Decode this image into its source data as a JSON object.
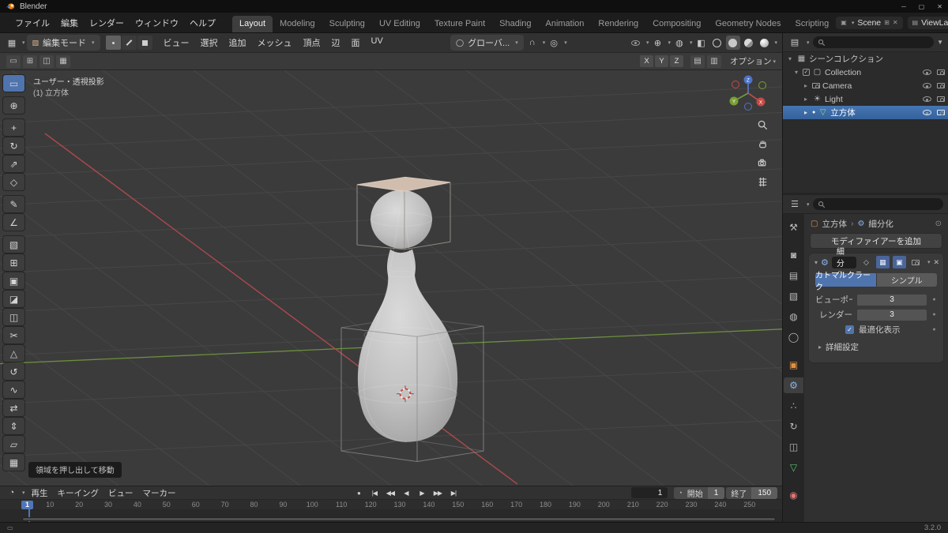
{
  "titlebar": {
    "title": "Blender"
  },
  "topbar": {
    "menus": [
      {
        "name": "file",
        "label": "ファイル"
      },
      {
        "name": "edit",
        "label": "編集"
      },
      {
        "name": "render",
        "label": "レンダー"
      },
      {
        "name": "window",
        "label": "ウィンドウ"
      },
      {
        "name": "help",
        "label": "ヘルプ"
      }
    ],
    "tabs": [
      {
        "name": "layout",
        "label": "Layout",
        "active": true
      },
      {
        "name": "modeling",
        "label": "Modeling"
      },
      {
        "name": "sculpting",
        "label": "Sculpting"
      },
      {
        "name": "uv-editing",
        "label": "UV Editing"
      },
      {
        "name": "texture-paint",
        "label": "Texture Paint"
      },
      {
        "name": "shading",
        "label": "Shading"
      },
      {
        "name": "animation",
        "label": "Animation"
      },
      {
        "name": "rendering",
        "label": "Rendering"
      },
      {
        "name": "compositing",
        "label": "Compositing"
      },
      {
        "name": "geometry-nodes",
        "label": "Geometry Nodes"
      },
      {
        "name": "scripting",
        "label": "Scripting"
      }
    ],
    "scene": {
      "label": "Scene"
    },
    "viewlayer": {
      "label": "ViewLayer"
    }
  },
  "viewport_header": {
    "mode": {
      "label": "編集モード"
    },
    "menus": [
      {
        "name": "view",
        "label": "ビュー"
      },
      {
        "name": "select",
        "label": "選択"
      },
      {
        "name": "add",
        "label": "追加"
      },
      {
        "name": "mesh",
        "label": "メッシュ"
      },
      {
        "name": "vertex",
        "label": "頂点"
      },
      {
        "name": "edge",
        "label": "辺"
      },
      {
        "name": "face",
        "label": "面"
      },
      {
        "name": "uv",
        "label": "UV"
      }
    ],
    "orientation": {
      "label": "グローバ..."
    }
  },
  "tool_settings": {
    "mirror_axes": [
      "X",
      "Y",
      "Z"
    ],
    "options_label": "オプション"
  },
  "tools": [
    {
      "name": "select-box",
      "glyph": "▭",
      "active": true
    },
    {
      "name": "cursor",
      "glyph": "⊕",
      "gap": true
    },
    {
      "name": "move",
      "glyph": "+",
      "gap": true
    },
    {
      "name": "rotate",
      "glyph": "↻"
    },
    {
      "name": "scale",
      "glyph": "⇗"
    },
    {
      "name": "transform",
      "glyph": "◇"
    },
    {
      "name": "annotate",
      "glyph": "✎",
      "gap": true
    },
    {
      "name": "measure",
      "glyph": "∠"
    },
    {
      "name": "add-cube",
      "glyph": "▧",
      "gap": true
    },
    {
      "name": "extrude-region",
      "glyph": "⊞"
    },
    {
      "name": "inset-faces",
      "glyph": "▣"
    },
    {
      "name": "bevel",
      "glyph": "◪"
    },
    {
      "name": "loop-cut",
      "glyph": "◫"
    },
    {
      "name": "knife",
      "glyph": "✂"
    },
    {
      "name": "poly-build",
      "glyph": "△"
    },
    {
      "name": "spin",
      "glyph": "↺"
    },
    {
      "name": "smooth",
      "glyph": "∿"
    },
    {
      "name": "edge-slide",
      "glyph": "⇄"
    },
    {
      "name": "shrink-fatten",
      "glyph": "⇕"
    },
    {
      "name": "shear",
      "glyph": "▱"
    },
    {
      "name": "rip-region",
      "glyph": "▦"
    }
  ],
  "viewport": {
    "view_label": "ユーザー・透視投影",
    "object_label": "(1) 立方体",
    "hint": "領域を押し出して移動",
    "gizmo_axes": [
      "X",
      "Y",
      "Z"
    ]
  },
  "outliner": {
    "rows": [
      {
        "name": "scene-collection",
        "label": "シーンコレクション"
      },
      {
        "name": "collection",
        "label": "Collection"
      },
      {
        "name": "camera",
        "label": "Camera"
      },
      {
        "name": "light",
        "label": "Light"
      },
      {
        "name": "cube",
        "label": "立方体",
        "selected": true
      }
    ]
  },
  "properties": {
    "tabs": [
      {
        "name": "tool",
        "glyph": "⚒",
        "color": "#b8b8b8"
      },
      {
        "name": "render",
        "glyph": "◙",
        "color": "#b8b8b8",
        "gap": true
      },
      {
        "name": "output",
        "glyph": "▤",
        "color": "#b8b8b8"
      },
      {
        "name": "view-layer",
        "glyph": "▧",
        "color": "#b8b8b8"
      },
      {
        "name": "scene",
        "glyph": "◍",
        "color": "#b8b8b8"
      },
      {
        "name": "world",
        "glyph": "◯",
        "color": "#b8b8b8"
      },
      {
        "name": "object",
        "glyph": "▣",
        "color": "#e0913f",
        "gap": true
      },
      {
        "name": "modifiers",
        "glyph": "⚙",
        "color": "#8ab4e8",
        "active": true
      },
      {
        "name": "particles",
        "glyph": "∴",
        "color": "#b8b8b8"
      },
      {
        "name": "physics",
        "glyph": "↻",
        "color": "#b8b8b8"
      },
      {
        "name": "constraints",
        "glyph": "◫",
        "color": "#b8b8b8"
      },
      {
        "name": "object-data",
        "glyph": "▽",
        "color": "#58c06e"
      },
      {
        "name": "material",
        "glyph": "◉",
        "color": "#d97878",
        "gap": true
      }
    ],
    "breadcrumb": {
      "object": "立方体",
      "modifier": "細分化"
    },
    "add_button": "モディファイアーを追加",
    "modifier": {
      "name": "細分化",
      "algorithms": [
        {
          "label": "カトマルクラーク",
          "active": true
        },
        {
          "label": "シンプル",
          "active": false
        }
      ],
      "fields": [
        {
          "label": "ビューポートのレ..",
          "value": "3"
        },
        {
          "label": "レンダー",
          "value": "3"
        }
      ],
      "checkbox": {
        "label": "最適化表示",
        "checked": true
      },
      "advanced_label": "詳細設定"
    }
  },
  "timeline": {
    "menus": [
      {
        "name": "playback",
        "label": "再生"
      },
      {
        "name": "keying",
        "label": "キーイング"
      },
      {
        "name": "view",
        "label": "ビュー"
      },
      {
        "name": "marker",
        "label": "マーカー"
      }
    ],
    "transport": [
      {
        "name": "jump-to-start",
        "glyph": "|◀"
      },
      {
        "name": "jump-prev-keyframe",
        "glyph": "◀◀"
      },
      {
        "name": "play-reverse",
        "glyph": "◀"
      },
      {
        "name": "play",
        "glyph": "▶"
      },
      {
        "name": "jump-next-keyframe",
        "glyph": "▶▶"
      },
      {
        "name": "jump-to-end",
        "glyph": "▶|"
      }
    ],
    "current_frame": "1",
    "start_label": "開始",
    "start_value": "1",
    "end_label": "終了",
    "end_value": "150",
    "ticks": [
      1,
      10,
      20,
      30,
      40,
      50,
      60,
      70,
      80,
      90,
      100,
      110,
      120,
      130,
      140,
      150,
      160,
      170,
      180,
      190,
      200,
      210,
      220,
      230,
      240,
      250
    ]
  },
  "statusbar": {
    "version": "3.2.0"
  }
}
